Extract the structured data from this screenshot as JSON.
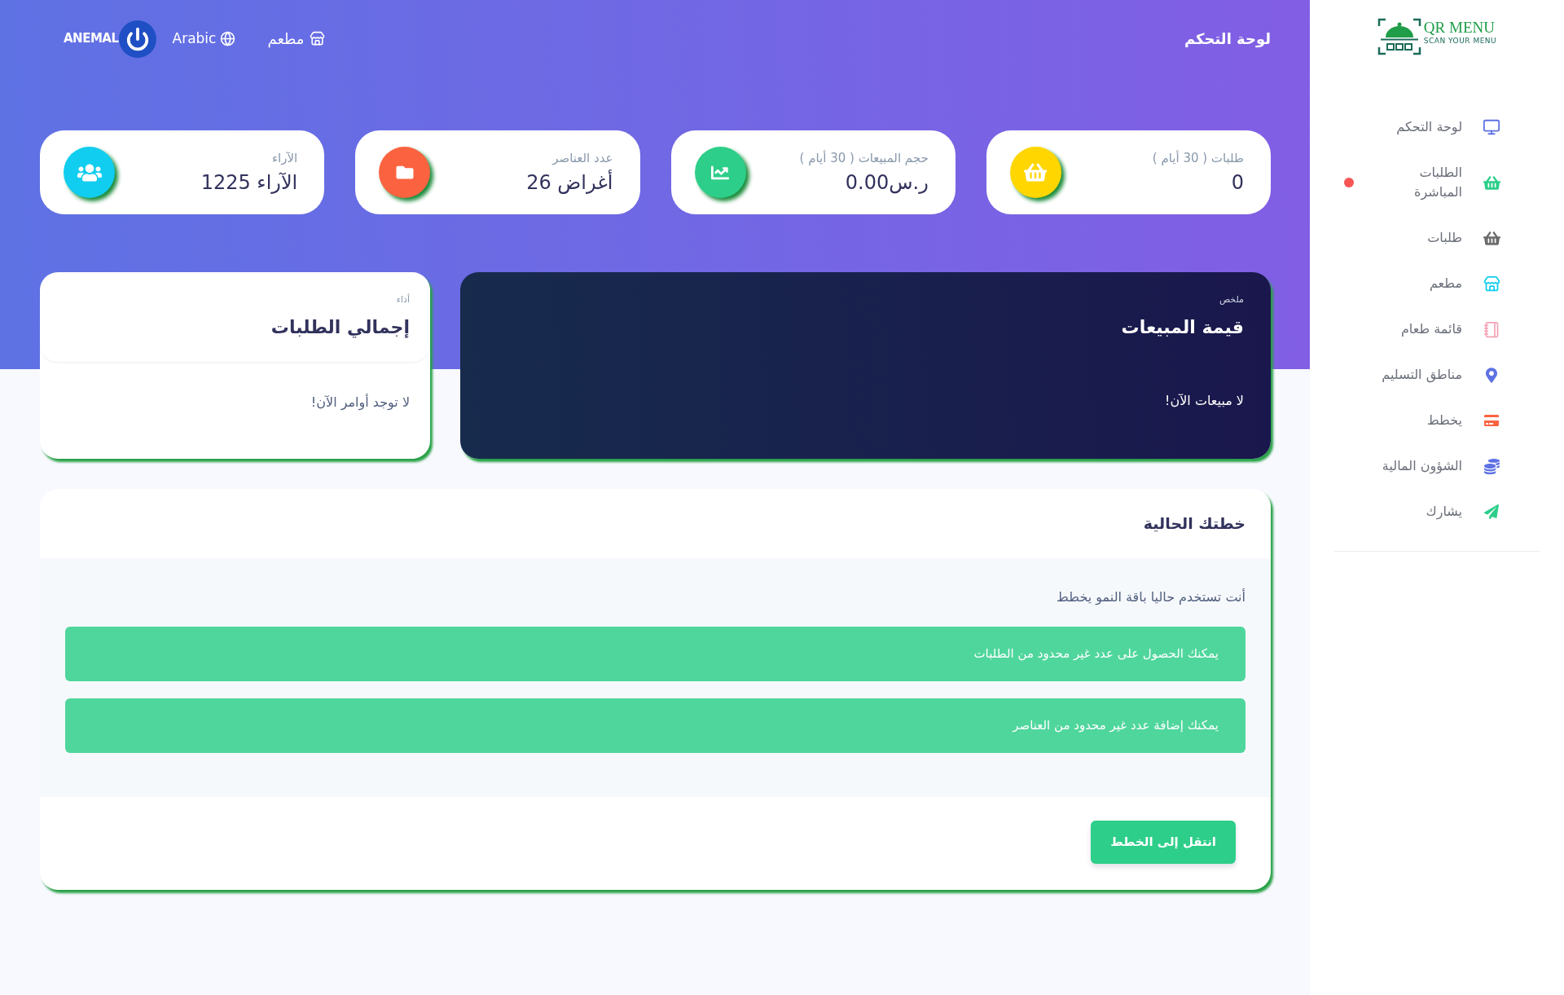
{
  "sidebar": {
    "logo": {
      "title": "QR MENU",
      "tagline": "SCAN YOUR MENU"
    },
    "items": [
      {
        "label": "لوحة التحكم",
        "color": "#5e72e4",
        "notification": false
      },
      {
        "label": "الطلبات المباشرة",
        "color": "#2dce89",
        "notification": true
      },
      {
        "label": "طلبات",
        "color": "#6c6c6c",
        "notification": false
      },
      {
        "label": "مطعم",
        "color": "#11cdef",
        "notification": false
      },
      {
        "label": "قائمة طعام",
        "color": "#f3a4b5",
        "notification": false
      },
      {
        "label": "مناطق التسليم",
        "color": "#5e72e4",
        "notification": false
      },
      {
        "label": "يخطط",
        "color": "#fb6340",
        "notification": false
      },
      {
        "label": "الشؤون المالية",
        "color": "#5e72e4",
        "notification": false
      },
      {
        "label": "يشارك",
        "color": "#2dce89",
        "notification": false
      }
    ]
  },
  "navbar": {
    "title": "لوحة التحكم",
    "restaurant_link": "مطعم",
    "language": "Arabic",
    "user": {
      "name": "ANEMAL"
    }
  },
  "stats": [
    {
      "label": "طلبات ( 30 أيام )",
      "value": "0",
      "color": "#ffd600"
    },
    {
      "label": "حجم المبيعات ( 30 أيام )",
      "value": "ر.س0.00",
      "color": "#2dce89"
    },
    {
      "label": "عدد العناصر",
      "value": "26 أغراض",
      "color": "#fb6340"
    },
    {
      "label": "الآراء",
      "value": "1225 الآراء",
      "color": "#11cdef"
    }
  ],
  "sales_card": {
    "overline": "ملخص",
    "title": "قيمة المبيعات",
    "message": "لا مبيعات الآن!"
  },
  "orders_card": {
    "overline": "أداء",
    "title": "إجمالي الطلبات",
    "message": "لا توجد أوامر الآن!"
  },
  "plan_card": {
    "title": "خطتك الحالية",
    "description": "أنت تستخدم حاليا باقة النمو يخطط",
    "features": [
      "يمكنك الحصول على عدد غير محدود من الطلبات",
      "يمكنك إضافة عدد غير محدود من العناصر"
    ],
    "button": "انتقل إلى الخطط"
  }
}
